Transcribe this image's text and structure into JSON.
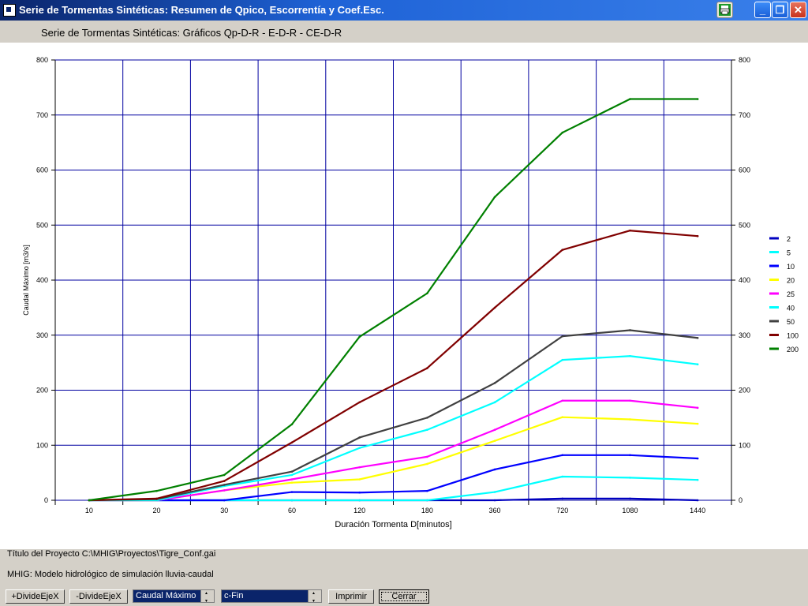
{
  "window": {
    "title": "Serie de Tormentas Sintéticas: Resumen de Qpico, Escorrentía y Coef.Esc.",
    "controls": {
      "minimize": "_",
      "maximize": "❐",
      "close": "✕"
    }
  },
  "header": {
    "chart_heading": "Serie de Tormentas Sintéticas: Gráficos Qp-D-R  -  E-D-R  -  CE-D-R"
  },
  "footer": {
    "project_label": "Título del Proyecto  C:\\MHIG\\Proyectos\\Tigre_Conf.gai",
    "model_label": "MHIG: Modelo hidrológico de simulación lluvia-caudal"
  },
  "toolbar": {
    "increase_axis_label": "+DivideEjeX",
    "decrease_axis_label": "-DivideEjeX",
    "variable_select": "Caudal Máximo",
    "method_select": "c-Fin",
    "print_label": "Imprimir",
    "close_label": "Cerrar"
  },
  "chart_data": {
    "type": "line",
    "xlabel": "Duración Tormenta D[minutos]",
    "ylabel": "Caudal Máximo [m3/s]",
    "categories": [
      "10",
      "20",
      "30",
      "60",
      "120",
      "180",
      "360",
      "720",
      "1080",
      "1440"
    ],
    "ylim": [
      0,
      800
    ],
    "yticks": [
      0,
      100,
      200,
      300,
      400,
      500,
      600,
      700,
      800
    ],
    "grid": true,
    "legend_position": "right",
    "series": [
      {
        "name": "2",
        "color": "#0000c0",
        "values": [
          0,
          0,
          0,
          0,
          0,
          0,
          0,
          3,
          3,
          0
        ]
      },
      {
        "name": "5",
        "color": "#00ffff",
        "values": [
          0,
          0,
          0,
          0,
          0,
          0,
          15,
          43,
          41,
          37
        ]
      },
      {
        "name": "10",
        "color": "#0000ff",
        "values": [
          0,
          0,
          0,
          15,
          14,
          17,
          56,
          82,
          82,
          76
        ]
      },
      {
        "name": "20",
        "color": "#ffff00",
        "values": [
          0,
          0,
          18,
          32,
          38,
          66,
          108,
          151,
          147,
          139
        ]
      },
      {
        "name": "25",
        "color": "#ff00ff",
        "values": [
          0,
          0,
          18,
          38,
          60,
          79,
          128,
          181,
          181,
          168
        ]
      },
      {
        "name": "40",
        "color": "#00ffff",
        "values": [
          0,
          0,
          26,
          46,
          95,
          128,
          178,
          255,
          262,
          247
        ]
      },
      {
        "name": "50",
        "color": "#404040",
        "values": [
          0,
          2,
          28,
          52,
          114,
          150,
          213,
          298,
          309,
          295
        ]
      },
      {
        "name": "100",
        "color": "#800000",
        "values": [
          0,
          3,
          35,
          105,
          178,
          240,
          350,
          455,
          490,
          480
        ]
      },
      {
        "name": "200",
        "color": "#008000",
        "values": [
          0,
          17,
          46,
          138,
          297,
          376,
          551,
          668,
          729,
          729
        ]
      }
    ]
  }
}
